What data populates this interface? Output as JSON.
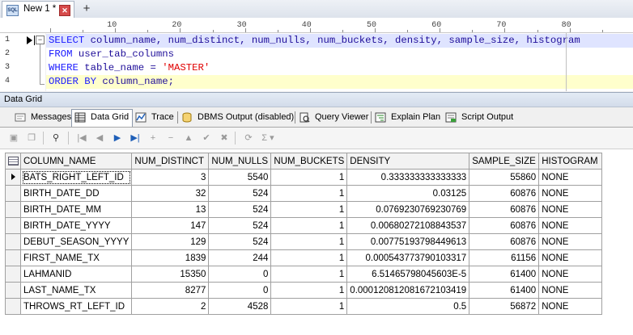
{
  "doc_tabs": [
    {
      "label": "New 1 *",
      "icon_label": "SQL"
    }
  ],
  "new_tab_label": "+",
  "ruler": {
    "labels": [
      "10",
      "20",
      "30",
      "40",
      "50",
      "60",
      "70",
      "80"
    ]
  },
  "editor": {
    "line_numbers": [
      "1",
      "2",
      "3",
      "4"
    ],
    "lines": [
      [
        {
          "t": "SELECT",
          "c": "kw"
        },
        {
          "t": " column_name, num_distinct, num_nulls, num_buckets, density, sample_size, histogram",
          "c": "id"
        }
      ],
      [
        {
          "t": "FROM",
          "c": "kw"
        },
        {
          "t": " user_tab_columns",
          "c": "id"
        }
      ],
      [
        {
          "t": "WHERE",
          "c": "kw"
        },
        {
          "t": " table_name = ",
          "c": "id"
        },
        {
          "t": "'MASTER'",
          "c": "str"
        }
      ],
      [
        {
          "t": "ORDER BY",
          "c": "kw"
        },
        {
          "t": " column_name;",
          "c": "id"
        }
      ]
    ]
  },
  "panel_title": "Data Grid",
  "result_tabs": [
    {
      "label": "Messages",
      "icon": "messages-icon"
    },
    {
      "label": "Data Grid",
      "icon": "grid-icon"
    },
    {
      "label": "Trace",
      "icon": "trace-icon"
    },
    {
      "label": "DBMS Output (disabled)",
      "icon": "dbms-output-icon"
    },
    {
      "label": "Query Viewer",
      "icon": "query-viewer-icon"
    },
    {
      "label": "Explain Plan",
      "icon": "explain-plan-icon"
    },
    {
      "label": "Script Output",
      "icon": "script-output-icon"
    }
  ],
  "active_result_tab": "Data Grid",
  "toolbar_icons": [
    "save-icon",
    "copy-icon",
    "binoculars-icon",
    "first-record-icon",
    "previous-record-icon",
    "next-record-icon",
    "last-record-icon",
    "insert-record-icon",
    "delete-record-icon",
    "edit-record-icon",
    "post-edit-icon",
    "cancel-edit-icon",
    "refresh-icon",
    "sum-icon"
  ],
  "grid": {
    "columns": [
      "COLUMN_NAME",
      "NUM_DISTINCT",
      "NUM_NULLS",
      "NUM_BUCKETS",
      "DENSITY",
      "SAMPLE_SIZE",
      "HISTOGRAM"
    ],
    "rows": [
      [
        "BATS_RIGHT_LEFT_ID",
        "3",
        "5540",
        "1",
        "0.333333333333333",
        "55860",
        "NONE"
      ],
      [
        "BIRTH_DATE_DD",
        "32",
        "524",
        "1",
        "0.03125",
        "60876",
        "NONE"
      ],
      [
        "BIRTH_DATE_MM",
        "13",
        "524",
        "1",
        "0.0769230769230769",
        "60876",
        "NONE"
      ],
      [
        "BIRTH_DATE_YYYY",
        "147",
        "524",
        "1",
        "0.00680272108843537",
        "60876",
        "NONE"
      ],
      [
        "DEBUT_SEASON_YYYY",
        "129",
        "524",
        "1",
        "0.00775193798449613",
        "60876",
        "NONE"
      ],
      [
        "FIRST_NAME_TX",
        "1839",
        "244",
        "1",
        "0.000543773790103317",
        "61156",
        "NONE"
      ],
      [
        "LAHMANID",
        "15350",
        "0",
        "1",
        "6.51465798045603E-5",
        "61400",
        "NONE"
      ],
      [
        "LAST_NAME_TX",
        "8277",
        "0",
        "1",
        "0.000120812081672103419",
        "61400",
        "NONE"
      ],
      [
        "THROWS_RT_LEFT_ID",
        "2",
        "4528",
        "1",
        "0.5",
        "56872",
        "NONE"
      ]
    ],
    "current_row": 0
  },
  "colors": {
    "keyword": "#1a1aff",
    "string": "#e00000",
    "identifier": "#1e0d99",
    "current_line": "#ffffcc"
  }
}
